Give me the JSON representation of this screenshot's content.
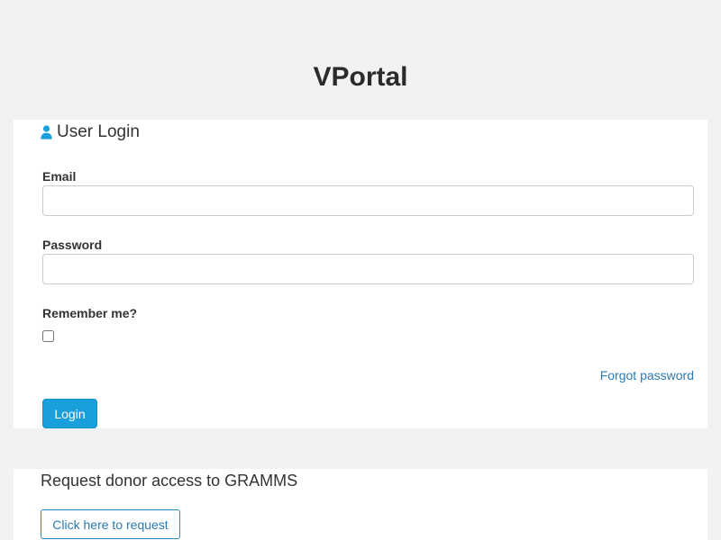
{
  "app": {
    "title": "VPortal"
  },
  "login_panel": {
    "heading": "User Login",
    "heading_icon": "user-icon",
    "email_label": "Email",
    "email_value": "",
    "email_placeholder": "",
    "password_label": "Password",
    "password_value": "",
    "password_placeholder": "",
    "remember_label": "Remember me?",
    "remember_checked": false,
    "forgot_label": "Forgot password",
    "login_label": "Login"
  },
  "request_panel": {
    "heading": "Request donor access to GRAMMS",
    "button_label": "Click here to request"
  },
  "colors": {
    "background": "#f1f2f3",
    "panel": "#ffffff",
    "accent": "#1a9fdd",
    "link": "#2a7ab5"
  }
}
